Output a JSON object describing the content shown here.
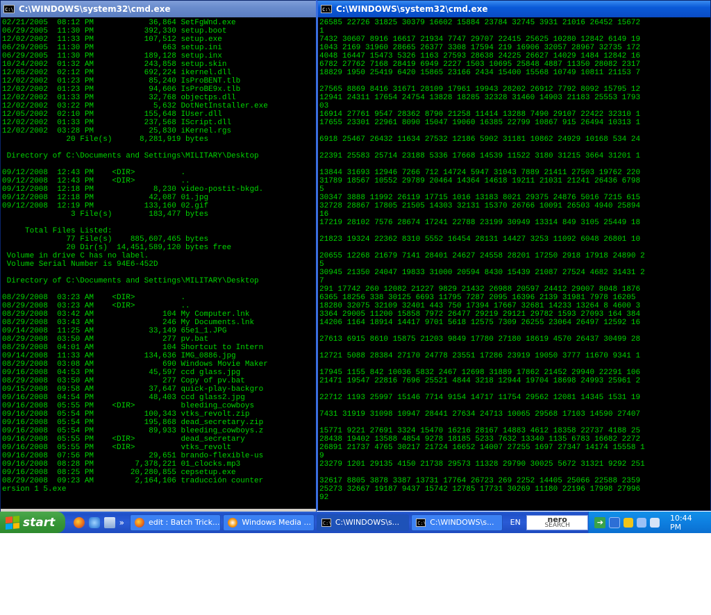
{
  "window_left": {
    "title": "C:\\WINDOWS\\system32\\cmd.exe",
    "console_text": "02/21/2005  08:12 PM            36,864 SetFgWnd.exe\n06/29/2005  11:30 PM           392,330 setup.boot\n12/02/2002  11:33 PM           107,512 setup.exe\n06/29/2005  11:30 PM               663 setup.ini\n06/29/2005  11:30 PM           189,128 setup.inx\n10/24/2002  01:32 AM           243,858 setup.skin\n12/05/2002  02:12 PM           692,224 ikernel.dll\n12/02/2002  01:23 PM            85,240 IsProBENT.tlb\n12/02/2002  01:23 PM            94,606 IsProBE9x.tlb\n12/02/2002  01:33 PM            32,768 objectps.dll\n12/02/2002  03:22 PM             5,632 DotNetInstaller.exe\n12/05/2002  02:10 PM           155,648 IUser.dll\n12/02/2002  01:33 PM           237,568 IScript.dll\n12/02/2002  03:28 PM            25,830 iKernel.rgs\n              20 File(s)      8,281,919 bytes\n\n Directory of C:\\Documents and Settings\\MILITARY\\Desktop\n\n09/12/2008  12:43 PM    <DIR>          .\n09/12/2008  12:43 PM    <DIR>          ..\n09/12/2008  12:18 PM             8,230 video-postit-bkgd.\n09/12/2008  12:18 PM            42,087 01.jpg\n09/12/2008  12:19 PM           133,160 02.gif\n               3 File(s)        183,477 bytes\n\n     Total Files Listed:\n              77 File(s)    885,607,465 bytes\n              20 Dir(s)  14,451,589,120 bytes free\n Volume in drive C has no label.\n Volume Serial Number is 94E6-452D\n\n Directory of C:\\Documents and Settings\\MILITARY\\Desktop\n\n08/29/2008  03:23 AM    <DIR>          .\n08/29/2008  03:23 AM    <DIR>          ..\n08/29/2008  03:42 AM               104 My Computer.lnk\n08/29/2008  03:43 AM               246 My Documents.lnk\n09/14/2008  11:25 AM            33,149 65e1_1.JPG\n08/29/2008  03:50 AM               277 pv.bat\n08/29/2008  04:01 AM               104 Shortcut to Intern\n09/14/2008  11:33 AM           134,636 IMG_0886.jpg\n08/29/2008  03:08 AM               690 Windows Movie Maker\n09/16/2008  04:53 PM            45,597 ccd glass.jpg\n08/29/2008  03:50 AM               277 Copy of pv.bat\n09/15/2008  09:58 AM            37,647 quick-play-backgro\n09/16/2008  04:54 PM            48,403 ccd glass2.jpg\n09/16/2008  05:55 PM    <DIR>          bleeding_cowboys\n09/16/2008  05:54 PM           100,343 vtks_revolt.zip\n09/16/2008  05:54 PM           195,868 dead_secretary.zip\n09/16/2008  05:54 PM            89,933 bleeding_cowboys.z\n09/16/2008  05:55 PM    <DIR>          dead_secretary\n09/16/2008  05:55 PM    <DIR>          vtks_revolt\n09/16/2008  07:56 PM            29,651 brando-flexible-us\n09/16/2008  08:28 PM         7,378,221 01_clocks.mp3\n09/16/2008  08:25 PM        20,280,855 cepsetup.exe\n08/29/2008  09:23 AM         2,164,106 traducción counter\nersion 1 5.exe"
  },
  "window_right": {
    "title": "C:\\WINDOWS\\system32\\cmd.exe",
    "console_text": "26585 22726 31825 30379 16602 15884 23784 32745 3931 21016 26452 15672\n1\n7432 30607 8916 16617 21934 7747 29707 22415 25625 10280 12842 6149 19\n1043 2169 31960 28665 26377 3308 17594 219 16906 32057 28967 32735 172\n4048 16447 15473 5326 1163 27593 28638 24225 26627 14029 1484 12842 16\n6782 27762 7168 28419 6949 2227 1503 10695 25848 4887 11350 28082 2317\n18829 1950 25419 6420 15865 23166 2434 15400 15568 10749 10811 21153 7\n\n27565 8869 8416 31671 28109 17961 19943 28202 26912 7792 8092 15795 12\n12941 24311 17654 24754 13828 18285 32328 31460 14903 21183 25553 1793\n03\n16914 27761 9547 28362 8790 21258 11414 13288 7490 29107 22422 32310 1\n17655 23301 22961 8090 15047 19060 16385 22799 10867 915 26494 10313 1\n\n6918 25467 26432 11634 27532 12186 5902 31181 10862 24929 10168 534 24\n\n22391 25583 25714 23188 5336 17668 14539 11522 3180 31215 3664 31201 1\n\n13844 31693 12946 7266 712 14724 5947 31043 7889 21411 27503 19762 220\n31789 18567 10552 29789 20464 14364 14618 19211 21031 21241 26436 6798\n5\n30347 3888 11992 26119 17715 1016 13183 8021 29375 24876 5016 7215 615\n32728 28867 17805 21505 14303 32131 15370 26766 10091 26503 4940 25894\n16\n17219 28102 7576 28674 17241 22788 23199 30949 13314 849 3105 25449 18\n\n21823 19324 22362 8310 5552 16454 28131 14427 3253 11092 6048 26801 10\n\n20655 12268 21679 7141 28401 24627 24558 28201 17250 2918 17918 24890 2\n5\n30945 21350 24047 19833 31000 20594 8430 15439 21087 27524 4682 31431 2\n7\n291 17742 260 12082 21227 9829 21432 26988 20597 24412 29007 8048 1876\n6365 18256 338 30125 6693 11795 7287 2095 16396 2139 31981 7978 16205\n18280 32075 32109 32401 443 750 17394 17667 32681 14233 13264 8 4600 3\n3364 29005 11200 15858 7972 26477 29219 29121 29782 1593 27093 164 384\n14206 1164 18914 14417 9701 5618 12575 7309 26255 23064 26497 12592 16\n\n27613 6915 8610 15875 21203 9849 17780 27180 18619 4570 26437 30499 28\n\n12721 5088 28384 27170 24778 23551 17286 23919 19050 3777 11670 9341 1\n\n17945 1155 842 10036 5832 2467 12698 31889 17862 21452 29940 22291 106\n21471 19547 22816 7696 25521 4844 3218 12944 19704 18698 24993 25961 2\n\n22712 1193 25997 15146 7714 9154 14717 11754 29562 12081 14345 1531 19\n\n7431 31919 31098 10947 28441 27634 24713 10065 29568 17103 14590 27407\n\n15771 9221 27691 3324 15470 16216 28167 14883 4612 18358 22737 4188 25\n28438 19402 13588 4854 9278 18185 5233 7632 13340 1135 6783 16682 2272\n26891 21737 4765 30217 21724 16652 14007 27255 1697 27347 14174 15558 1\n9\n23279 1201 29135 4150 21738 29573 11328 29790 30025 5672 31321 9292 251\n\n32617 8805 3878 3387 13731 17764 26723 269 2252 14405 25066 22588 2359\n25273 32667 19187 9437 15742 12785 17731 30269 11180 22196 17998 27996\n92"
  },
  "taskbar": {
    "start_label": "start",
    "tasks": [
      {
        "label": "edit : Batch Trick..."
      },
      {
        "label": "Windows Media ..."
      },
      {
        "label": "C:\\WINDOWS\\s..."
      },
      {
        "label": "C:\\WINDOWS\\s..."
      }
    ],
    "more_label": "»",
    "language": "EN",
    "nero_top": "nero",
    "nero_bottom": "SEARCH",
    "clock": "10:44 PM"
  },
  "colors": {
    "console_text": "#00d400",
    "console_bg": "#000000",
    "titlebar_active": "#0a5ad8",
    "taskbar": "#2a5bd6",
    "start": "#3b9a3b"
  },
  "icons": [
    "cmd-icon",
    "windows-flag-icon",
    "firefox-icon",
    "ie-icon",
    "show-desktop-icon",
    "go-arrow-icon",
    "network-icon",
    "volume-icon"
  ]
}
